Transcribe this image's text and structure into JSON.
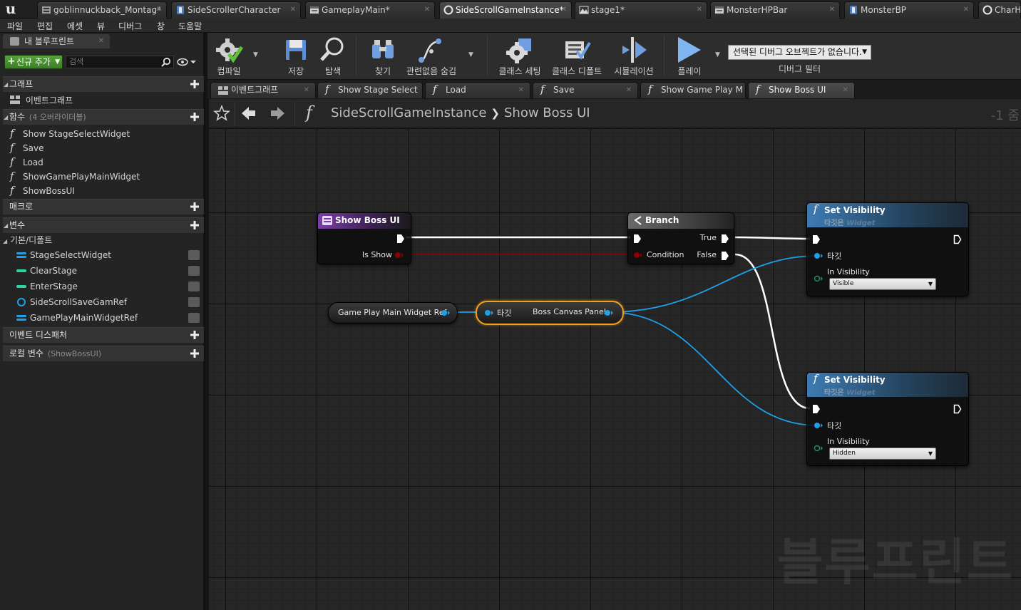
{
  "app": {
    "logo": "u"
  },
  "tabs": [
    {
      "label": "goblinnuckback_Montag*",
      "icon": "animation-montage-icon",
      "active": false
    },
    {
      "label": "SideScrollerCharacter",
      "icon": "blueprint-class-icon",
      "active": false
    },
    {
      "label": "GameplayMain*",
      "icon": "widget-blueprint-icon",
      "active": false
    },
    {
      "label": "SideScrollGameInstance*",
      "icon": "game-instance-icon",
      "active": true
    },
    {
      "label": "stage1*",
      "icon": "level-icon",
      "active": false
    },
    {
      "label": "MonsterHPBar",
      "icon": "widget-blueprint-icon",
      "active": false
    },
    {
      "label": "MonsterBP",
      "icon": "blueprint-class-icon",
      "active": false
    },
    {
      "label": "CharH",
      "icon": "game-instance-icon",
      "active": false
    }
  ],
  "menu": [
    "파일",
    "편집",
    "에셋",
    "뷰",
    "디버그",
    "창",
    "도움말"
  ],
  "left_panel": {
    "tab_title": "내 블루프린트",
    "add_new_label": "신규 추가",
    "search_placeholder": "검색",
    "sections": {
      "graphs": "그래프",
      "event_graph": "이벤트그래프",
      "functions": "함수",
      "functions_sub": "(4 오버라이더블)",
      "macros": "매크로",
      "variables": "변수",
      "components": "기본/디폴트",
      "event_dispatchers": "이벤트 디스패처",
      "local_vars": "로컬 변수",
      "local_vars_sub": "(ShowBossUI)"
    },
    "functions": [
      "Show StageSelectWidget",
      "Save",
      "Load",
      "ShowGamePlayMainWidget",
      "ShowBossUI"
    ],
    "variables": [
      {
        "name": "StageSelectWidget",
        "type_color": "#1fa0e6",
        "type": "object"
      },
      {
        "name": "ClearStage",
        "type_color": "#2fd3a8",
        "type": "int"
      },
      {
        "name": "EnterStage",
        "type_color": "#2fd3a8",
        "type": "int"
      },
      {
        "name": "SideScrollSaveGamRef",
        "type_color": "#1fa0e6",
        "type": "object"
      },
      {
        "name": "GamePlayMainWidgetRef",
        "type_color": "#1fa0e6",
        "type": "object"
      }
    ]
  },
  "toolbar": {
    "compile": "컴파일",
    "save": "저장",
    "browse": "탐색",
    "find": "찾기",
    "hide_unrelated": "관련없음 숨김",
    "class_settings": "클래스 세팅",
    "class_defaults": "클래스 디폴트",
    "simulation": "시뮬레이션",
    "play": "플레이",
    "debug_object": "선택된 디버그 오브젝트가 없습니다.",
    "debug_filter": "디버그 필터"
  },
  "graph_tabs": [
    {
      "label": "이벤트그래프",
      "kind": "event-graph",
      "active": false
    },
    {
      "label": "Show Stage Select",
      "kind": "function",
      "active": false
    },
    {
      "label": "Load",
      "kind": "function",
      "active": false
    },
    {
      "label": "Save",
      "kind": "function",
      "active": false
    },
    {
      "label": "Show Game Play M",
      "kind": "function",
      "active": false
    },
    {
      "label": "Show Boss UI",
      "kind": "function",
      "active": true
    }
  ],
  "breadcrumb": {
    "class_name": "SideScrollGameInstance",
    "function_name": "Show Boss UI",
    "zoom": "-1 줌"
  },
  "graph": {
    "entry_node": {
      "title": "Show Boss UI",
      "param": "Is Show"
    },
    "branch_node": {
      "title": "Branch",
      "condition": "Condition",
      "true_label": "True",
      "false_label": "False"
    },
    "set_vis_1": {
      "title": "Set Visibility",
      "subtitle": "타깃은",
      "subtitle_type": "Widget",
      "target": "타깃",
      "in_visibility": "In Visibility",
      "value": "Visible"
    },
    "set_vis_2": {
      "title": "Set Visibility",
      "subtitle": "타깃은",
      "subtitle_type": "Widget",
      "target": "타깃",
      "in_visibility": "In Visibility",
      "value": "Hidden"
    },
    "ref_node": {
      "label": "Game Play Main Widget Ref"
    },
    "panel_node": {
      "target": "타깃",
      "label": "Boss Canvas Panel"
    },
    "watermark": "블루프린트"
  },
  "colors": {
    "exec": "#ffffff",
    "bool": "#8c0000",
    "object": "#1fa0e6",
    "selection": "#f0a020"
  }
}
